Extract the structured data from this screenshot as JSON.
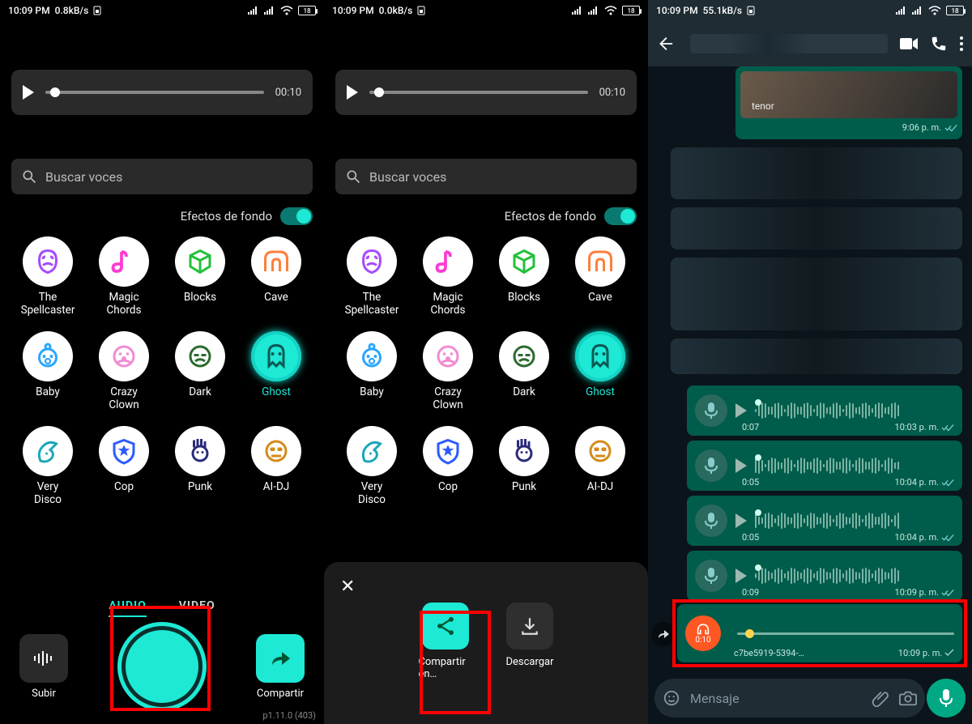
{
  "panels": [
    {
      "status": {
        "time": "10:09 PM",
        "speed": "0.8kB/s",
        "battery": "18"
      },
      "duration": "00:10"
    },
    {
      "status": {
        "time": "10:09 PM",
        "speed": "0.0kB/s",
        "battery": "18"
      },
      "duration": "00:10"
    },
    {
      "status": {
        "time": "10:09 PM",
        "speed": "55.1kB/s",
        "battery": "18"
      }
    }
  ],
  "search_placeholder": "Buscar voces",
  "toggle_label": "Efectos de fondo",
  "voices": [
    {
      "id": "spellcaster",
      "label": "The Spellcaster",
      "svg_color": "#a54cff"
    },
    {
      "id": "magic",
      "label": "Magic Chords",
      "svg_color": "#ff3bd4"
    },
    {
      "id": "blocks",
      "label": "Blocks",
      "svg_color": "#23c03b"
    },
    {
      "id": "cave",
      "label": "Cave",
      "svg_color": "#ff7e3b"
    },
    {
      "id": "baby",
      "label": "Baby",
      "svg_color": "#2aa6ff"
    },
    {
      "id": "clown",
      "label": "Crazy Clown",
      "svg_color": "#f18bd4"
    },
    {
      "id": "dark",
      "label": "Dark",
      "svg_color": "#2c6b2f"
    },
    {
      "id": "ghost",
      "label": "Ghost",
      "svg_color": "#1de9d5",
      "selected": true
    },
    {
      "id": "disco",
      "label": "Very Disco",
      "svg_color": "#1aa8b8"
    },
    {
      "id": "cop",
      "label": "Cop",
      "svg_color": "#2d5bff"
    },
    {
      "id": "punk",
      "label": "Punk",
      "svg_color": "#2b2b7a"
    },
    {
      "id": "aidj",
      "label": "AI-DJ",
      "svg_color": "#d38b1a"
    }
  ],
  "tabs": {
    "audio": "AUDIO",
    "video": "VIDEO"
  },
  "bottom": {
    "upload": "Subir",
    "share": "Compartir",
    "version": "p1.11.0 (403)"
  },
  "sheet": {
    "share": "Compartir en…",
    "download": "Descargar"
  },
  "wa": {
    "gif": {
      "tag": "tenor",
      "ts": "9:06 p. m."
    },
    "voices": [
      {
        "dur": "0:07",
        "ts": "10:03 p. m."
      },
      {
        "dur": "0:05",
        "ts": "10:04 p. m."
      },
      {
        "dur": "0:05",
        "ts": "10:04 p. m."
      },
      {
        "dur": "0:09",
        "ts": "10:09 p. m."
      }
    ],
    "new_audio": {
      "dur": "0:10",
      "file": "c7be5919-5394-…",
      "ts": "10:09 p. m."
    },
    "input_placeholder": "Mensaje"
  }
}
